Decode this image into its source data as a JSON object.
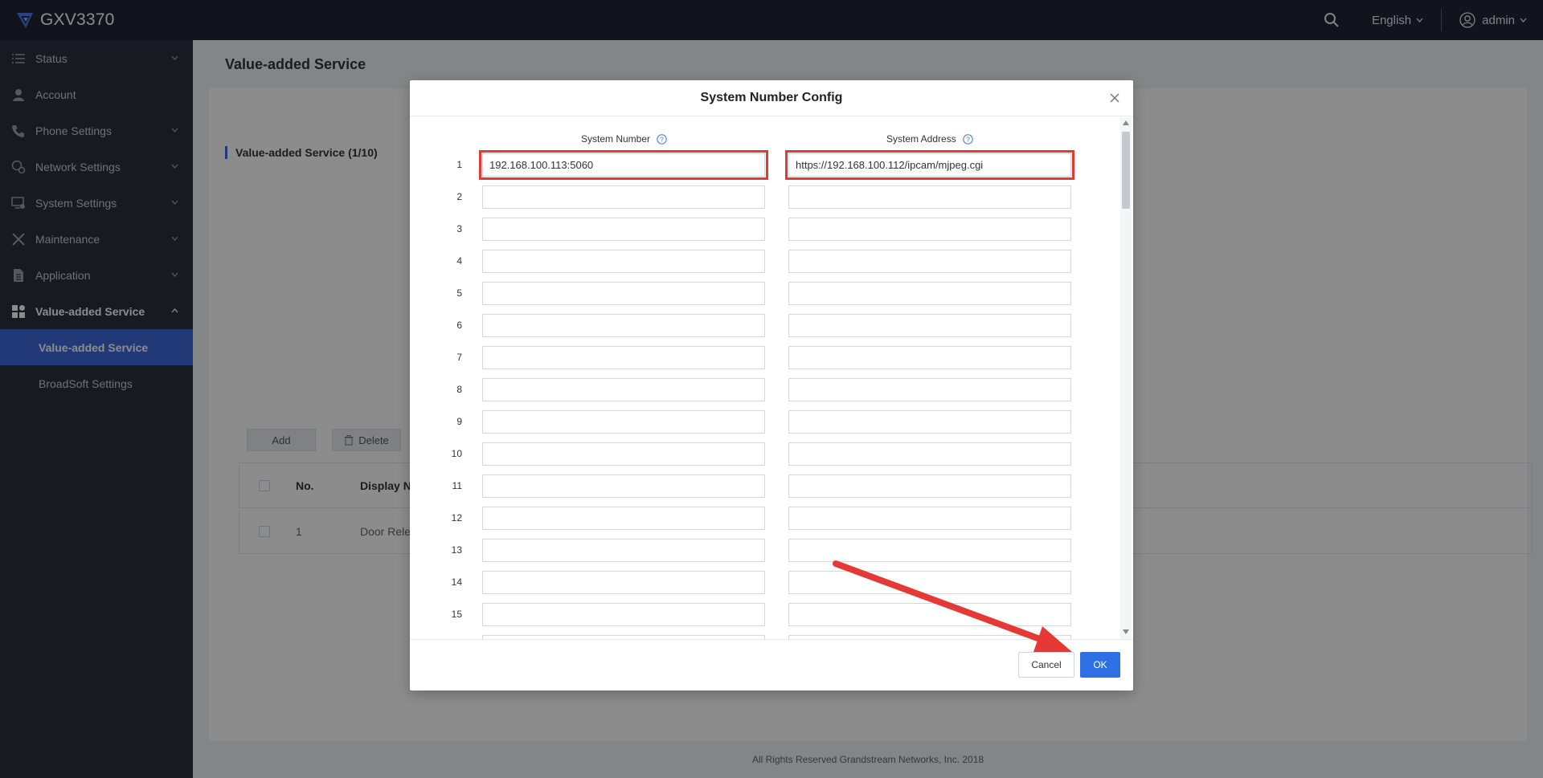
{
  "app": {
    "title": "GXV3370"
  },
  "header": {
    "language": "English",
    "user": "admin"
  },
  "sidebar": {
    "items": [
      {
        "label": "Status",
        "icon": "list-icon",
        "has_chevron": true
      },
      {
        "label": "Account",
        "icon": "person-icon",
        "has_chevron": false
      },
      {
        "label": "Phone Settings",
        "icon": "phone-icon",
        "has_chevron": true
      },
      {
        "label": "Network Settings",
        "icon": "network-icon",
        "has_chevron": true
      },
      {
        "label": "System Settings",
        "icon": "monitor-icon",
        "has_chevron": true
      },
      {
        "label": "Maintenance",
        "icon": "tools-icon",
        "has_chevron": true
      },
      {
        "label": "Application",
        "icon": "document-icon",
        "has_chevron": true
      },
      {
        "label": "Value-added Service",
        "icon": "grid-icon",
        "has_chevron": true,
        "expanded": true
      }
    ],
    "sub_items": [
      {
        "label": "Value-added Service",
        "active": true
      },
      {
        "label": "BroadSoft Settings",
        "active": false
      }
    ]
  },
  "main": {
    "page_title": "Value-added Service",
    "section_title": "Value-added Service (1/10)",
    "add_label": "Add",
    "delete_label": "Delete",
    "table": {
      "headers": {
        "no": "No.",
        "name": "Display Nam"
      },
      "rows": [
        {
          "no": "1",
          "name": "Door Release"
        }
      ]
    },
    "footer": "All Rights Reserved Grandstream Networks, Inc. 2018"
  },
  "modal": {
    "title": "System Number Config",
    "col_number": "System Number",
    "col_address": "System Address",
    "rows": [
      {
        "n": "1",
        "number": "192.168.100.113:5060",
        "address": "https://192.168.100.112/ipcam/mjpeg.cgi"
      },
      {
        "n": "2",
        "number": "",
        "address": ""
      },
      {
        "n": "3",
        "number": "",
        "address": ""
      },
      {
        "n": "4",
        "number": "",
        "address": ""
      },
      {
        "n": "5",
        "number": "",
        "address": ""
      },
      {
        "n": "6",
        "number": "",
        "address": ""
      },
      {
        "n": "7",
        "number": "",
        "address": ""
      },
      {
        "n": "8",
        "number": "",
        "address": ""
      },
      {
        "n": "9",
        "number": "",
        "address": ""
      },
      {
        "n": "10",
        "number": "",
        "address": ""
      },
      {
        "n": "11",
        "number": "",
        "address": ""
      },
      {
        "n": "12",
        "number": "",
        "address": ""
      },
      {
        "n": "13",
        "number": "",
        "address": ""
      },
      {
        "n": "14",
        "number": "",
        "address": ""
      },
      {
        "n": "15",
        "number": "",
        "address": ""
      }
    ],
    "cancel_label": "Cancel",
    "ok_label": "OK"
  },
  "colors": {
    "accent": "#3d6bd9",
    "ok_button": "#2f6fe4",
    "highlight": "#e53935",
    "topbar": "#1f2633",
    "sidebar": "#2b303b"
  }
}
